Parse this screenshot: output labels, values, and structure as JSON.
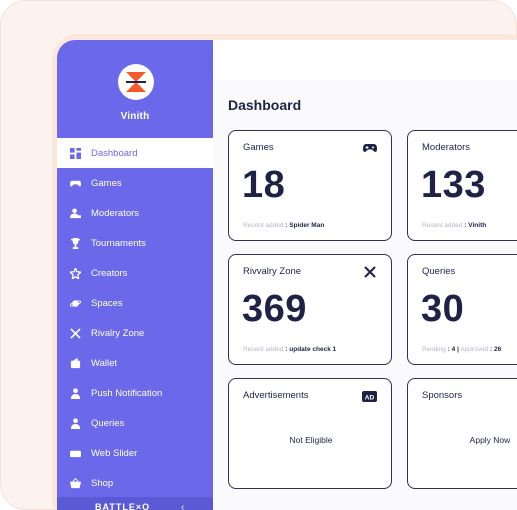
{
  "app": {
    "brand_name": "Vinith",
    "footer_brand": "BATTLE×O",
    "accent": "#6b68e9",
    "logo_colors": [
      "#f55a2c",
      "#1e2246"
    ]
  },
  "sidebar": {
    "items": [
      {
        "label": "Dashboard",
        "icon": "grid-icon",
        "active": true
      },
      {
        "label": "Games",
        "icon": "gamepad-icon"
      },
      {
        "label": "Moderators",
        "icon": "moderator-icon"
      },
      {
        "label": "Tournaments",
        "icon": "trophy-icon"
      },
      {
        "label": "Creators",
        "icon": "star-icon"
      },
      {
        "label": "Spaces",
        "icon": "planet-icon"
      },
      {
        "label": "Rivalry Zone",
        "icon": "crossed-swords-icon"
      },
      {
        "label": "Wallet",
        "icon": "wallet-icon"
      },
      {
        "label": "Push Notification",
        "icon": "user-icon"
      },
      {
        "label": "Queries",
        "icon": "user-icon"
      },
      {
        "label": "Web Slider",
        "icon": "slider-icon"
      },
      {
        "label": "Shop",
        "icon": "basket-icon"
      }
    ]
  },
  "main": {
    "title": "Dashboard",
    "cards": [
      {
        "title": "Games",
        "value": "18",
        "note_label": "Recent added",
        "note_value": ": Spider Man",
        "icon": "gamepad-icon"
      },
      {
        "title": "Moderators",
        "value": "133",
        "note_label": "Recent added",
        "note_value": ": Vinith"
      },
      {
        "title": "Rivvalry Zone",
        "value": "369",
        "note_label": "Recent added",
        "note_value": ": update check 1",
        "icon": "crossed-swords-icon"
      },
      {
        "title": "Queries",
        "value": "30",
        "note_label": "Pending",
        "note_value": ": 4 |",
        "note_label2": "Approved",
        "note_value2": ": 26"
      },
      {
        "title": "Advertisements",
        "center_text": "Not Eligible",
        "icon": "ad-icon"
      },
      {
        "title": "Sponsors",
        "center_text": "Apply Now"
      }
    ]
  }
}
